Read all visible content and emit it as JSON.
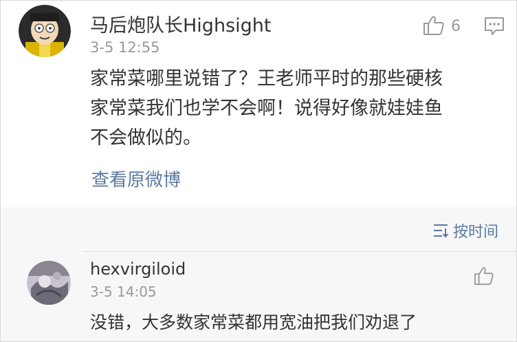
{
  "comment": {
    "username": "马后炮队长Highsight",
    "timestamp": "3-5 12:55",
    "like_count": "6",
    "lines": [
      "家常菜哪里说错了？王老师平时的那些硬核",
      "家常菜我们也学不会啊！说得好像就娃娃鱼",
      "不会做似的。"
    ],
    "view_original": "查看原微博"
  },
  "sort": {
    "label": "按时间",
    "icon": "sort-by-time-icon"
  },
  "reply": {
    "username": "hexvirgiloid",
    "timestamp": "3-5 14:05",
    "text": "没错，大多数家常菜都用宽油把我们劝退了"
  },
  "icons": {
    "like": "thumbs-up-icon",
    "comment": "comment-bubble-icon"
  },
  "colors": {
    "link": "#5b7aa2",
    "meta": "#999999",
    "text": "#333333"
  }
}
